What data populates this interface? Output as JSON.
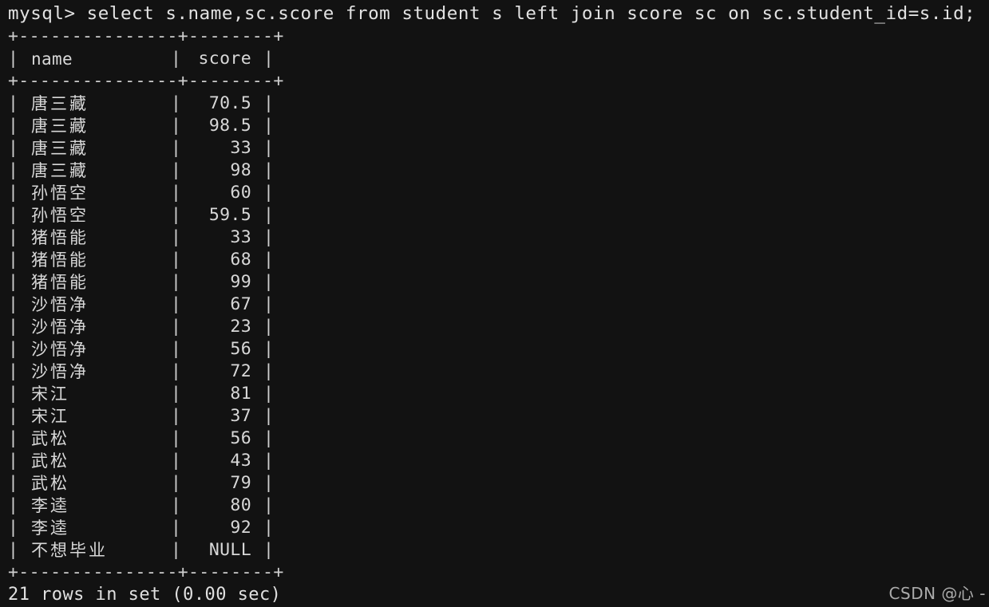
{
  "terminal": {
    "background_color": "#121212",
    "text_color": "#d6d6d6",
    "prompt": "mysql>",
    "query": "mysql> select s.name,sc.score from student s left join score sc on sc.student_id=s.id;",
    "rule": "+---------------+--------+",
    "header_line": "| name          | score  |",
    "footer_status": "21 rows in set (0.00 sec)"
  },
  "table": {
    "columns": [
      "name",
      "score"
    ],
    "rows": [
      {
        "name": "唐三藏",
        "score": "70.5"
      },
      {
        "name": "唐三藏",
        "score": "98.5"
      },
      {
        "name": "唐三藏",
        "score": "33"
      },
      {
        "name": "唐三藏",
        "score": "98"
      },
      {
        "name": "孙悟空",
        "score": "60"
      },
      {
        "name": "孙悟空",
        "score": "59.5"
      },
      {
        "name": "猪悟能",
        "score": "33"
      },
      {
        "name": "猪悟能",
        "score": "68"
      },
      {
        "name": "猪悟能",
        "score": "99"
      },
      {
        "name": "沙悟净",
        "score": "67"
      },
      {
        "name": "沙悟净",
        "score": "23"
      },
      {
        "name": "沙悟净",
        "score": "56"
      },
      {
        "name": "沙悟净",
        "score": "72"
      },
      {
        "name": "宋江",
        "score": "81"
      },
      {
        "name": "宋江",
        "score": "37"
      },
      {
        "name": "武松",
        "score": "56"
      },
      {
        "name": "武松",
        "score": "43"
      },
      {
        "name": "武松",
        "score": "79"
      },
      {
        "name": "李逵",
        "score": "80"
      },
      {
        "name": "李逵",
        "score": "92"
      },
      {
        "name": "不想毕业",
        "score": "NULL"
      }
    ],
    "row_count": 21
  },
  "watermark": {
    "text": "CSDN @心 -"
  }
}
